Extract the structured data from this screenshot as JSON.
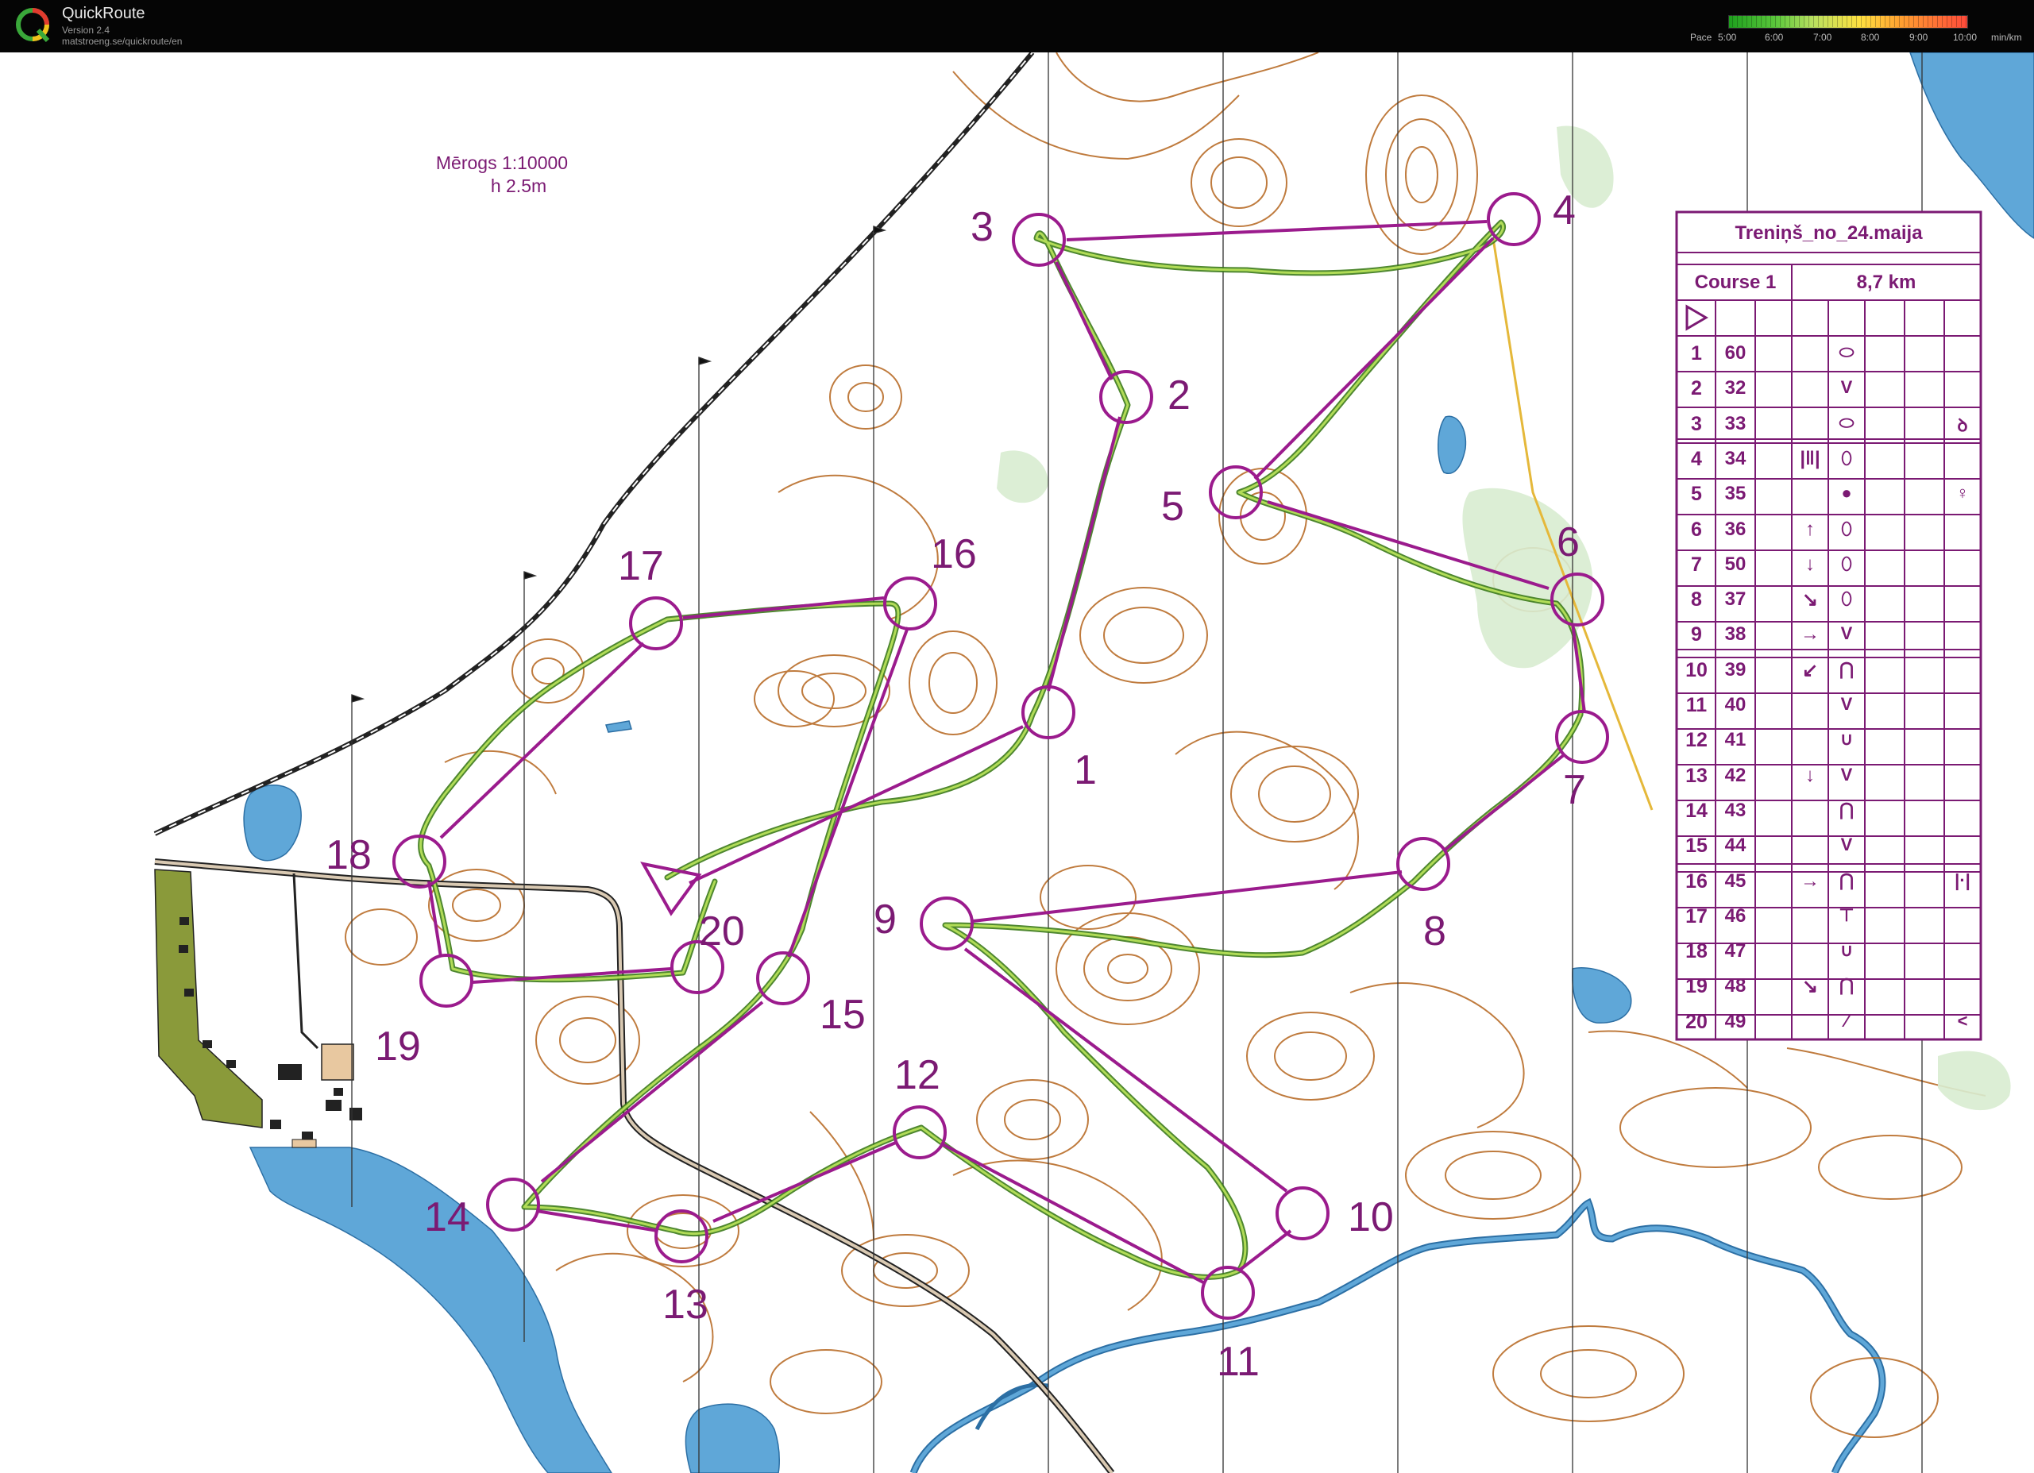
{
  "app": {
    "title": "QuickRoute",
    "version": "Version 2.4",
    "url": "matstroeng.se/quickroute/en"
  },
  "pace": {
    "label": "Pace",
    "ticks": [
      "5:00",
      "6:00",
      "7:00",
      "8:00",
      "9:00",
      "10:00"
    ],
    "unit": "min/km"
  },
  "map": {
    "scale_label": "Mērogs 1:10000",
    "contour_label": "h  2.5m",
    "colors": {
      "course": "#9b1b8d",
      "route": "#7cbf3a",
      "contour": "#b5651d",
      "water": "#5fa7d8",
      "highway": "#222222"
    }
  },
  "controls": [
    {
      "n": "1",
      "label": "1"
    },
    {
      "n": "2",
      "label": "2"
    },
    {
      "n": "3",
      "label": "3"
    },
    {
      "n": "4",
      "label": "4"
    },
    {
      "n": "5",
      "label": "5"
    },
    {
      "n": "6",
      "label": "6"
    },
    {
      "n": "7",
      "label": "7"
    },
    {
      "n": "8",
      "label": "8"
    },
    {
      "n": "9",
      "label": "9"
    },
    {
      "n": "10",
      "label": "10"
    },
    {
      "n": "11",
      "label": "11"
    },
    {
      "n": "12",
      "label": "12"
    },
    {
      "n": "13",
      "label": "13"
    },
    {
      "n": "14",
      "label": "14"
    },
    {
      "n": "15",
      "label": "15"
    },
    {
      "n": "16",
      "label": "16"
    },
    {
      "n": "17",
      "label": "17"
    },
    {
      "n": "18",
      "label": "18"
    },
    {
      "n": "19",
      "label": "19"
    },
    {
      "n": "20",
      "label": "20"
    }
  ],
  "description_sheet": {
    "title": "Treniņš_no_24.maija",
    "course": "Course 1",
    "length": "8,7 km",
    "rows": [
      {
        "num": "1",
        "code": "60",
        "dir": "",
        "feat": "⬭",
        "extra": ""
      },
      {
        "num": "2",
        "code": "32",
        "dir": "",
        "feat": "V",
        "extra": ""
      },
      {
        "num": "3",
        "code": "33",
        "dir": "",
        "feat": "⬭",
        "extra": "ꝺ"
      },
      {
        "num": "4",
        "code": "34",
        "dir": "|‖|",
        "feat": "⬯",
        "extra": ""
      },
      {
        "num": "5",
        "code": "35",
        "dir": "",
        "feat": "●",
        "extra": "♀"
      },
      {
        "num": "6",
        "code": "36",
        "dir": "↑",
        "feat": "⬯",
        "extra": ""
      },
      {
        "num": "7",
        "code": "50",
        "dir": "↓",
        "feat": "⬯",
        "extra": ""
      },
      {
        "num": "8",
        "code": "37",
        "dir": "↘",
        "feat": "⬯",
        "extra": ""
      },
      {
        "num": "9",
        "code": "38",
        "dir": "→",
        "feat": "V",
        "extra": ""
      },
      {
        "num": "10",
        "code": "39",
        "dir": "↙",
        "feat": "⋂",
        "extra": ""
      },
      {
        "num": "11",
        "code": "40",
        "dir": "",
        "feat": "V",
        "extra": ""
      },
      {
        "num": "12",
        "code": "41",
        "dir": "",
        "feat": "∪",
        "extra": ""
      },
      {
        "num": "13",
        "code": "42",
        "dir": "↓",
        "feat": "V",
        "extra": ""
      },
      {
        "num": "14",
        "code": "43",
        "dir": "",
        "feat": "⋂",
        "extra": ""
      },
      {
        "num": "15",
        "code": "44",
        "dir": "",
        "feat": "V",
        "extra": ""
      },
      {
        "num": "16",
        "code": "45",
        "dir": "→",
        "feat": "⋂",
        "extra": "|·|"
      },
      {
        "num": "17",
        "code": "46",
        "dir": "",
        "feat": "⊤",
        "extra": ""
      },
      {
        "num": "18",
        "code": "47",
        "dir": "",
        "feat": "∪",
        "extra": ""
      },
      {
        "num": "19",
        "code": "48",
        "dir": "↘",
        "feat": "⋂",
        "extra": ""
      },
      {
        "num": "20",
        "code": "49",
        "dir": "",
        "feat": "⁄",
        "extra": "<"
      }
    ]
  }
}
